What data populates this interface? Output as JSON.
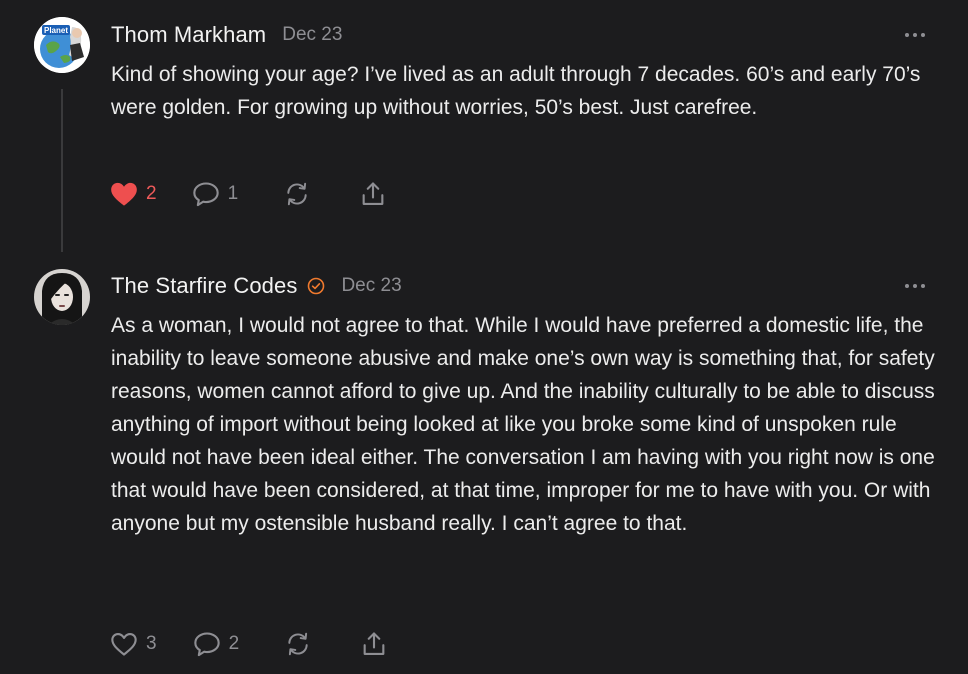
{
  "comments": [
    {
      "author": "Thom Markham",
      "date": "Dec 23",
      "body": "Kind of showing your age? I’ve lived as an adult through 7 decades. 60’s and early 70’s were golden. For growing up without worries, 50’s best. Just carefree.",
      "likes": "2",
      "liked": true,
      "replies": "1",
      "avatar_text": "Planet",
      "avatar_icon": "earth-avatar-icon"
    },
    {
      "author": "The Starfire Codes",
      "date": "Dec 23",
      "body": "As a woman, I would not agree to that. While I would have preferred a domestic life, the inability to leave someone abusive and make one’s own way is something that, for safety reasons, women cannot afford to give up. And the inability culturally to be able to discuss anything of import without being looked at like you broke some kind of unspoken rule would not have been ideal either. The conversation I am having with you right now is one that would have been considered, at that time, improper for me to have with you. Or with anyone but my ostensible husband really. I can’t agree to that.",
      "likes": "3",
      "liked": false,
      "replies": "2",
      "verified": true,
      "avatar_icon": "portrait-avatar-icon"
    }
  ],
  "colors": {
    "background": "#1c1c1e",
    "like_active": "#ee5a5a",
    "verified_badge": "#f07a2e",
    "muted": "#8e8e93"
  },
  "icons": {
    "like": "heart-icon",
    "reply": "speech-bubble-icon",
    "restack": "restack-icon",
    "share": "share-icon",
    "more": "ellipsis-icon"
  }
}
